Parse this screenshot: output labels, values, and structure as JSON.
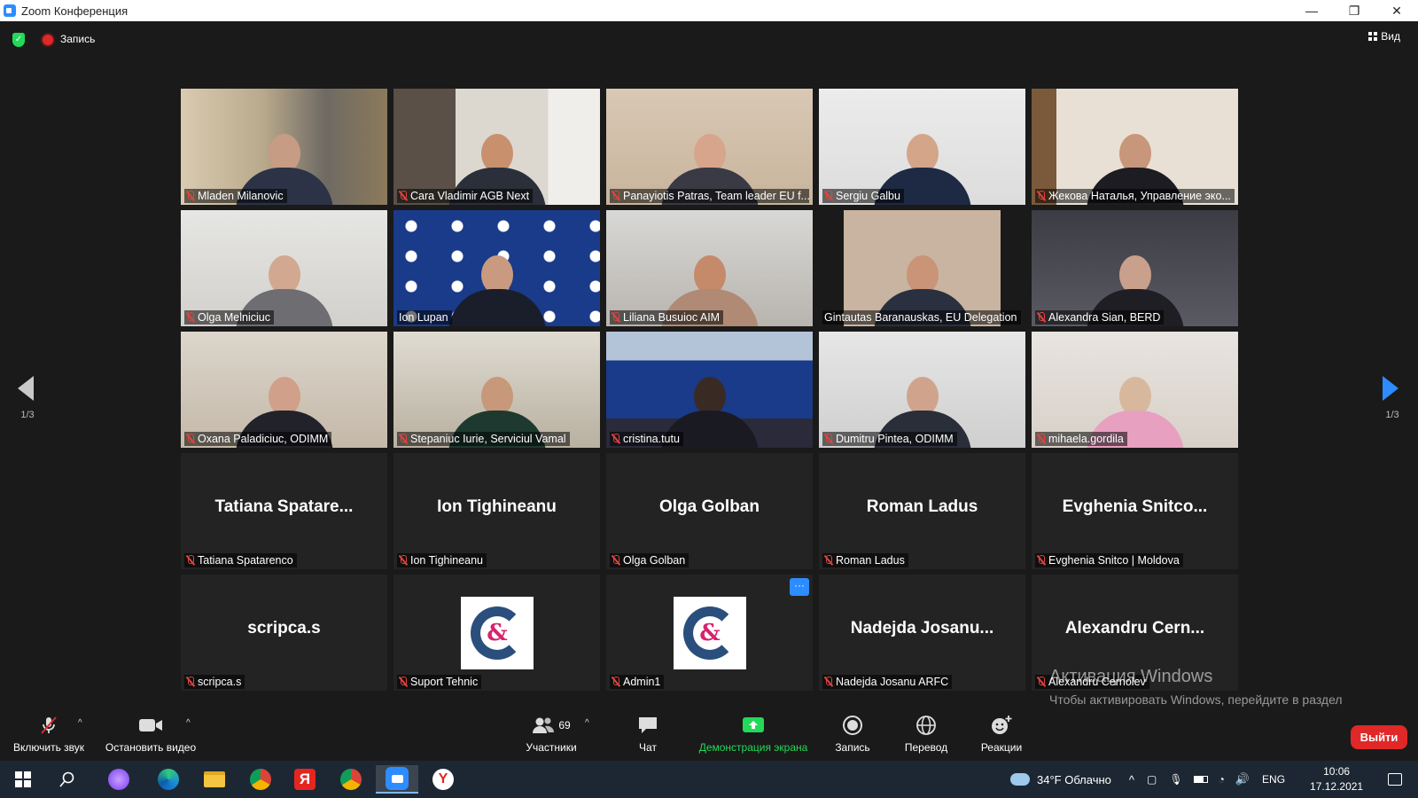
{
  "window": {
    "title": "Zoom Конференция",
    "minimize": "—",
    "restore": "❐",
    "close": "✕"
  },
  "meeting": {
    "recording_label": "Запись",
    "view_label": "Вид"
  },
  "pagination": {
    "left": "1/3",
    "right": "1/3"
  },
  "participants": [
    {
      "label": "Mladen Milanovic"
    },
    {
      "label": "Cara Vladimir AGB Next"
    },
    {
      "label": "Panayiotis Patras, Team leader EU f..."
    },
    {
      "label": "Sergiu Galbu"
    },
    {
      "label": "Жекова Наталья, Управление эко..."
    },
    {
      "label": "Olga Melniciuc"
    },
    {
      "label": "Ion Lupan"
    },
    {
      "label": "Liliana Busuioc AIM"
    },
    {
      "label": "Gintautas Baranauskas, EU Delegation"
    },
    {
      "label": "Alexandra Sian, BERD"
    },
    {
      "label": "Oxana Paladiciuc, ODIMM"
    },
    {
      "label": "Stepaniuc Iurie, Serviciul Vamal"
    },
    {
      "label": "cristina.tutu"
    },
    {
      "label": "Dumitru Pintea, ODIMM"
    },
    {
      "label": "mihaela.gordila"
    },
    {
      "label": "Tatiana Spatarenco",
      "display": "Tatiana  Spatare..."
    },
    {
      "label": "Ion Tighineanu",
      "display": "Ion Tighineanu"
    },
    {
      "label": "Olga Golban",
      "display": "Olga Golban"
    },
    {
      "label": "Roman Ladus",
      "display": "Roman Ladus"
    },
    {
      "label": "Evghenia Snitco | Moldova",
      "display": "Evghenia  Snitco..."
    },
    {
      "label": "scripca.s",
      "display": "scripca.s"
    },
    {
      "label": "Suport Tehnic",
      "logo_text": "&"
    },
    {
      "label": "Admin1",
      "logo_text": "&",
      "more": "···"
    },
    {
      "label": "Nadejda Josanu ARFC",
      "display": "Nadejda  Josanu..."
    },
    {
      "label": "Alexandru Cernolev",
      "display": "Alexandru  Cern..."
    }
  ],
  "watermark": {
    "title": "Активация Windows",
    "text": "Чтобы активировать Windows, перейдите в раздел \"Параметры\"."
  },
  "toolbar": {
    "unmute": "Включить звук",
    "stop_video": "Остановить видео",
    "participants": "Участники",
    "participants_count": "69",
    "chat": "Чат",
    "share": "Демонстрация экрана",
    "record": "Запись",
    "translate": "Перевод",
    "reactions": "Реакции",
    "leave": "Выйти"
  },
  "taskbar": {
    "weather": "34°F  Облачно",
    "lang": "ENG",
    "time": "10:06",
    "date": "17.12.2021"
  },
  "colors": {
    "accent": "#2d8cff",
    "share_green": "#23d959",
    "leave_red": "#e02828",
    "active_speaker": "#c6e234"
  }
}
